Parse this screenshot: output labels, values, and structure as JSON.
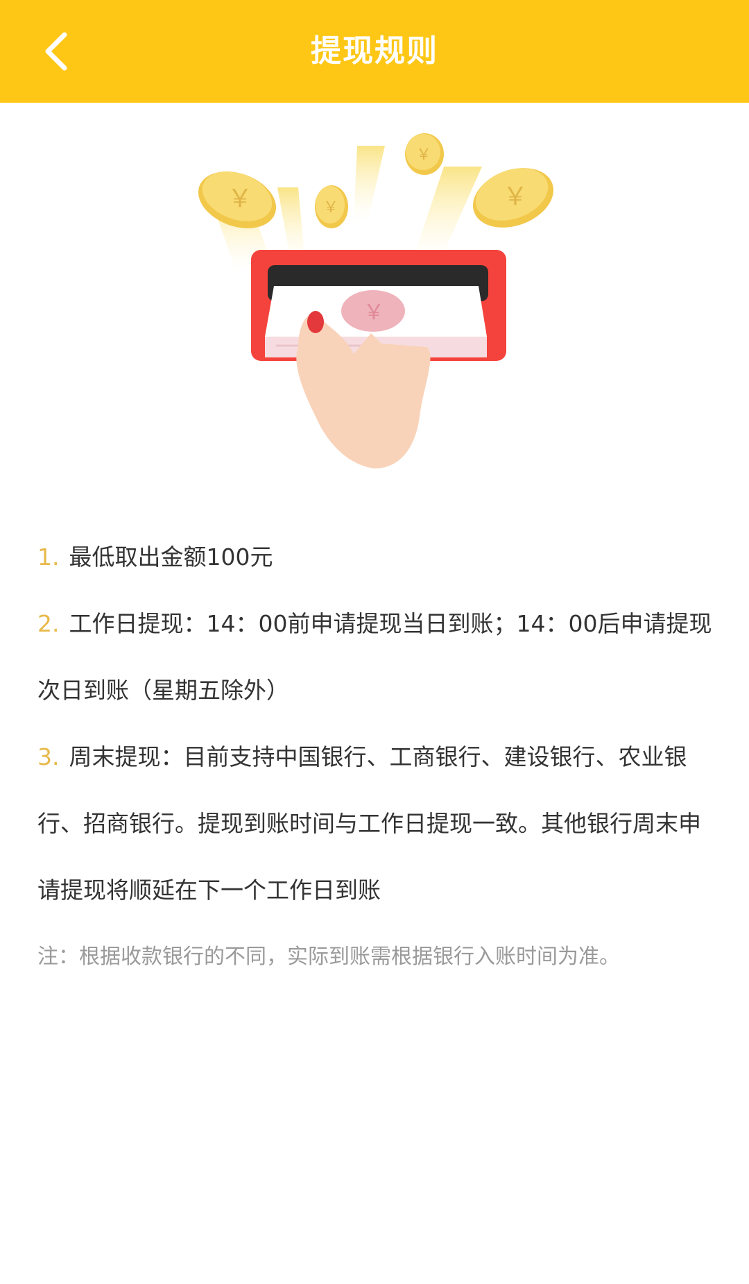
{
  "header": {
    "title": "提现规则",
    "back_icon": "chevron-left-icon",
    "color": "#FEC716"
  },
  "illustration": {
    "name": "withdraw-illustration",
    "coin_symbol": "￥",
    "colors": {
      "coin": "#F7D774",
      "slot": "#F4433C",
      "hand": "#F9D3B9"
    }
  },
  "rules": [
    {
      "num": "1.",
      "text": "最低取出金额100元"
    },
    {
      "num": "2.",
      "text": "工作日提现：14：00前申请提现当日到账；14：00后申请提现次日到账（星期五除外）"
    },
    {
      "num": "3.",
      "text": "周末提现：目前支持中国银行、工商银行、建设银行、农业银行、招商银行。提现到账时间与工作日提现一致。其他银行周末申请提现将顺延在下一个工作日到账"
    }
  ],
  "note": "注：根据收款银行的不同，实际到账需根据银行入账时间为准。",
  "colors": {
    "accent": "#E8B94A",
    "text": "#333333",
    "note": "#9a9a9a"
  }
}
